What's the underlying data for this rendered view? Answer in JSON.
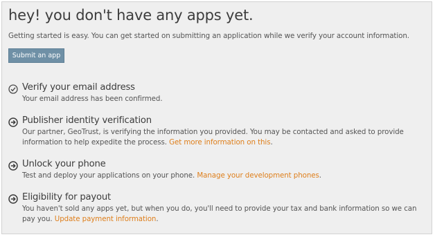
{
  "page": {
    "title": "hey! you don't have any apps yet.",
    "intro": "Getting started is easy. You can get started on submitting an application while we verify your account information.",
    "submit_label": "Submit an app"
  },
  "steps": [
    {
      "icon": "check-circle-icon",
      "title": "Verify your email address",
      "text": "Your email address has been confirmed.",
      "link": ""
    },
    {
      "icon": "arrow-right-circle-icon",
      "title": "Publisher identity verification",
      "text": "Our partner, GeoTrust, is verifying the information you provided. You may be contacted and asked to provide information to help expedite the process. ",
      "link": "Get more information on this",
      "after": "."
    },
    {
      "icon": "arrow-right-circle-icon",
      "title": "Unlock your phone",
      "text": "Test and deploy your applications on your phone. ",
      "link": "Manage your development phones",
      "after": "."
    },
    {
      "icon": "arrow-right-circle-icon",
      "title": "Eligibility for payout",
      "text": "You haven't sold any apps yet, but when you do, you'll need to provide your tax and bank information so we can pay you. ",
      "link": "Update payment information",
      "after": "."
    }
  ],
  "colors": {
    "background": "#efefef",
    "button": "#6f90a6",
    "link": "#de7f1c",
    "heading": "#3c3c3c"
  }
}
